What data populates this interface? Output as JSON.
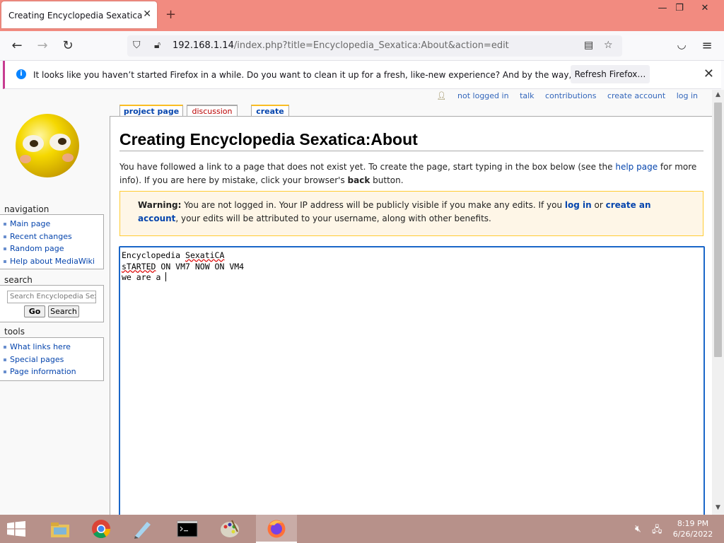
{
  "browser": {
    "tab_title": "Creating Encyclopedia Sexatica:About",
    "tab_close": "✕",
    "new_tab": "+",
    "url_host": "192.168.1.14",
    "url_path": "/index.php?title=Encyclopedia_Sexatica:About&action=edit",
    "window_controls": {
      "minimize": "—",
      "maximize": "❐",
      "close": "✕"
    }
  },
  "notification": {
    "icon": "i",
    "text": "It looks like you haven’t started Firefox in a while. Do you want to clean it up for a fresh, like-new experience? And by the way, welcome back!",
    "button": "Refresh Firefox…",
    "close": "✕"
  },
  "personal": {
    "items": [
      "not logged in",
      "talk",
      "contributions",
      "create account",
      "log in"
    ]
  },
  "content_tabs": {
    "project": "project page",
    "discussion": "discussion",
    "create": "create"
  },
  "sidebar": {
    "navigation": {
      "heading": "navigation",
      "items": [
        "Main page",
        "Recent changes",
        "Random page",
        "Help about MediaWiki"
      ]
    },
    "search": {
      "heading": "search",
      "placeholder": "Search Encyclopedia Sexatica",
      "go": "Go",
      "search": "Search"
    },
    "tools": {
      "heading": "tools",
      "items": [
        "What links here",
        "Special pages",
        "Page information"
      ]
    }
  },
  "page": {
    "heading": "Creating Encyclopedia Sexatica:About",
    "intro_1": "You have followed a link to a page that does not exist yet. To create the page, start typing in the box below (see the ",
    "intro_link": "help page",
    "intro_2": " for more info). If you are here by mistake, click your browser's ",
    "intro_bold": "back",
    "intro_3": " button.",
    "warning_bold": "Warning:",
    "warning_1": " You are not logged in. Your IP address will be publicly visible if you make any edits. If you ",
    "warning_login": "log in",
    "warning_or": " or ",
    "warning_create": "create an account",
    "warning_2": ", your edits will be attributed to your username, along with other benefits.",
    "editor": {
      "line1_a": "Encyclopedia ",
      "line1_b": "SexatiCA",
      "line2_a": "sTARTED",
      "line2_b": " ON VM7 NOW ON VM4",
      "line3": "we are a "
    }
  },
  "taskbar": {
    "time": "8:19 PM",
    "date": "6/26/2022"
  }
}
